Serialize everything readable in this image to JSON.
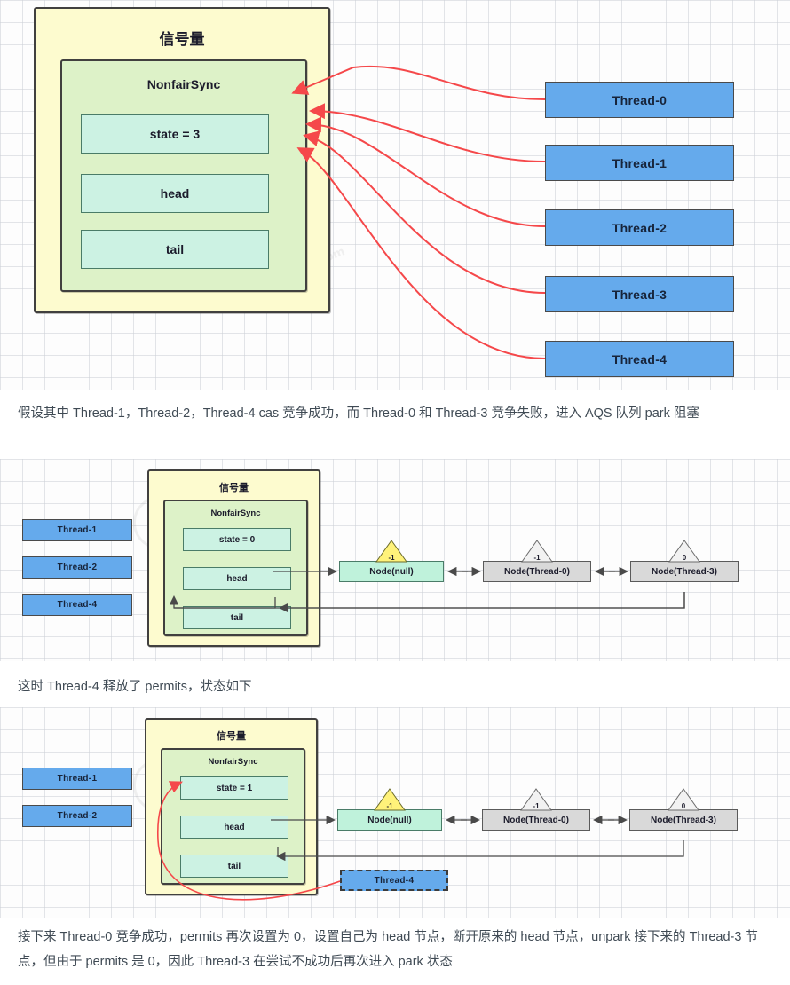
{
  "colors": {
    "thread_blue": "#65aaec",
    "semaphore_yellow": "#fdfbcf",
    "nonfair_green": "#ddf2c8",
    "field_teal": "#ccf2e3",
    "node_gray": "#d9d9d9",
    "node_green": "#bff2db",
    "arrow_red": "#f5484a",
    "waitstatus_yellow": "#fff27a",
    "corner_accent": "#f9544b",
    "text_body": "#3f4a54"
  },
  "diagram1": {
    "semaphore_title": "信号量",
    "nonfair_title": "NonfairSync",
    "fields": [
      {
        "label": "state = 3"
      },
      {
        "label": "head"
      },
      {
        "label": "tail"
      }
    ],
    "threads": [
      {
        "label": "Thread-0"
      },
      {
        "label": "Thread-1"
      },
      {
        "label": "Thread-2"
      },
      {
        "label": "Thread-3"
      },
      {
        "label": "Thread-4"
      }
    ]
  },
  "paragraph1": "假设其中 Thread-1，Thread-2，Thread-4 cas 竞争成功，而 Thread-0 和 Thread-3 竞争失败，进入 AQS 队列 park 阻塞",
  "diagram2": {
    "semaphore_title": "信号量",
    "nonfair_title": "NonfairSync",
    "fields": [
      {
        "label": "state = 0"
      },
      {
        "label": "head"
      },
      {
        "label": "tail"
      }
    ],
    "threads": [
      {
        "label": "Thread-1"
      },
      {
        "label": "Thread-2"
      },
      {
        "label": "Thread-4"
      }
    ],
    "nodes": [
      {
        "label": "Node(null)",
        "waitstatus": "-1",
        "style": "green"
      },
      {
        "label": "Node(Thread-0)",
        "waitstatus": "-1",
        "style": "gray"
      },
      {
        "label": "Node(Thread-3)",
        "waitstatus": "0",
        "style": "gray"
      }
    ]
  },
  "paragraph2": "这时 Thread-4 释放了 permits，状态如下",
  "diagram3": {
    "semaphore_title": "信号量",
    "nonfair_title": "NonfairSync",
    "fields": [
      {
        "label": "state = 1"
      },
      {
        "label": "head"
      },
      {
        "label": "tail"
      }
    ],
    "threads": [
      {
        "label": "Thread-1"
      },
      {
        "label": "Thread-2"
      }
    ],
    "released_thread": {
      "label": "Thread-4"
    },
    "nodes": [
      {
        "label": "Node(null)",
        "waitstatus": "-1",
        "style": "green"
      },
      {
        "label": "Node(Thread-0)",
        "waitstatus": "-1",
        "style": "gray"
      },
      {
        "label": "Node(Thread-3)",
        "waitstatus": "0",
        "style": "gray"
      }
    ]
  },
  "paragraph3": "接下来 Thread-0 竞争成功，permits 再次设置为 0，设置自己为 head 节点，断开原来的 head 节点，unpark 接下来的 Thread-3 节点，但由于 permits 是 0，因此 Thread-3 在尝试不成功后再次进入 park 状态",
  "watermark": {
    "text": "www.itheima.com"
  }
}
